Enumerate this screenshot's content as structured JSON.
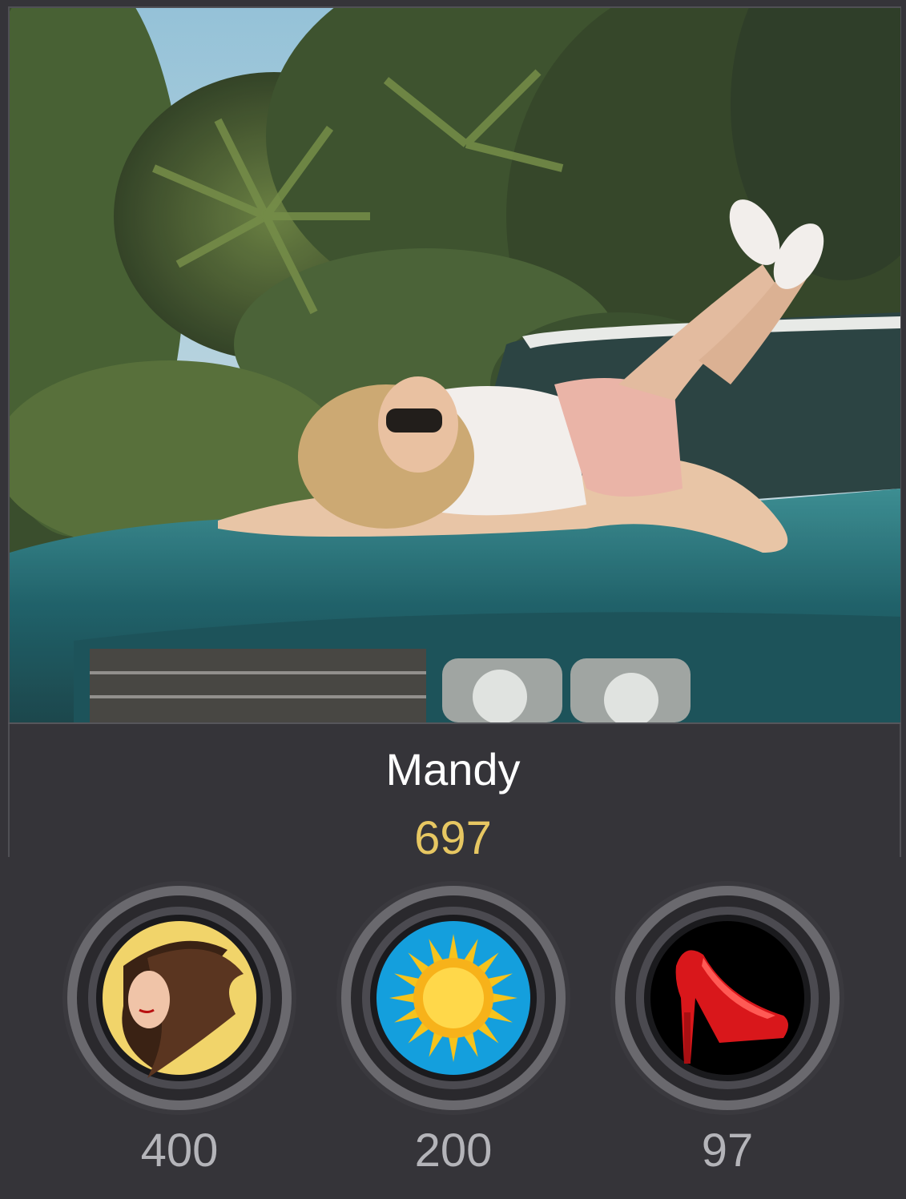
{
  "profile": {
    "name": "Mandy",
    "score": "697"
  },
  "badges": [
    {
      "icon": "hair-woman-icon",
      "value": "400",
      "bg": "#f1d46a"
    },
    {
      "icon": "sun-icon",
      "value": "200",
      "bg": "#149fdd"
    },
    {
      "icon": "high-heel-shoe-icon",
      "value": "97",
      "bg": "#000000"
    }
  ],
  "colors": {
    "background": "#353439",
    "name": "#ffffff",
    "score": "#e7c762",
    "badge_value": "#b4b4b9"
  }
}
